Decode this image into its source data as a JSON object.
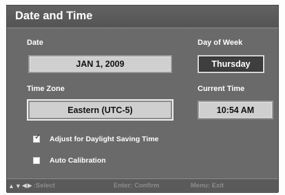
{
  "window": {
    "title": "Date and Time"
  },
  "date": {
    "label": "Date",
    "value": "JAN 1, 2009"
  },
  "day_of_week": {
    "label": "Day of Week",
    "value": "Thursday"
  },
  "time_zone": {
    "label": "Time Zone",
    "value": "Eastern (UTC-5)"
  },
  "current_time": {
    "label": "Current Time",
    "value": "10:54 AM"
  },
  "options": {
    "dst": {
      "label": "Adjust for Daylight Saving Time",
      "checked": true,
      "mark": "✓"
    },
    "auto_calibration": {
      "label": "Auto Calibration",
      "checked": false
    }
  },
  "footer": {
    "arrows": {
      "up": "▲",
      "down": "▼",
      "left": "◀",
      "right": "▶"
    },
    "select_hint": ":Select",
    "enter_hint": "Enter: Confirm",
    "menu_hint": "Menu: Exit"
  },
  "colors": {
    "panel": "#6a6a6a",
    "field_light": "#cfcfcf",
    "field_dark": "#3e3e3e",
    "text": "#ffffff",
    "hint_text": "#8c8c8c"
  },
  "icons": {
    "nav": [
      "up-arrow-icon",
      "down-arrow-icon",
      "left-arrow-icon",
      "right-arrow-icon"
    ],
    "check": "checkmark-icon"
  }
}
